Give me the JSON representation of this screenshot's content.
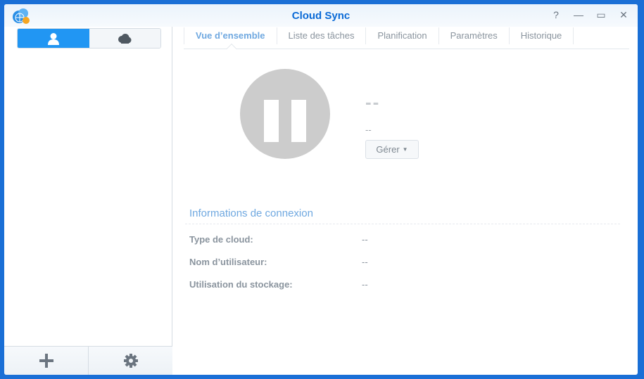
{
  "window": {
    "title": "Cloud Sync",
    "controls": [
      "?",
      "—",
      "▭",
      "✕"
    ]
  },
  "sidebar": {
    "segments": [
      {
        "icon": "user-icon"
      },
      {
        "icon": "cloud-icon"
      }
    ],
    "bottom": [
      {
        "icon": "plus-icon"
      },
      {
        "icon": "gear-icon"
      }
    ]
  },
  "tabs": [
    "Vue d’ensemble",
    "Liste des tâches",
    "Planification",
    "Paramètres",
    "Historique"
  ],
  "overview": {
    "name": "--",
    "status": "--",
    "manage_label": "Gérer"
  },
  "connection": {
    "title": "Informations de connexion",
    "rows": [
      {
        "label": "Type de cloud:",
        "value": "--"
      },
      {
        "label": "Nom d’utilisateur:",
        "value": "--"
      },
      {
        "label": "Utilisation du stockage:",
        "value": "--"
      }
    ]
  }
}
